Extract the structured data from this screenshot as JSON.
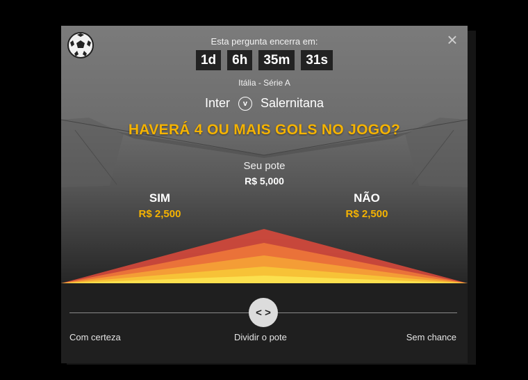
{
  "countdown": {
    "label": "Esta pergunta encerra em:",
    "days": "1d",
    "hours": "6h",
    "minutes": "35m",
    "seconds": "31s"
  },
  "match": {
    "league": "Itália - Série A",
    "home_team": "Inter",
    "vs_symbol": "v",
    "away_team": "Salernitana"
  },
  "question": "HAVERÁ 4 OU MAIS GOLS NO JOGO?",
  "pot": {
    "label": "Seu pote",
    "value": "R$ 5,000"
  },
  "sides": {
    "yes": {
      "label": "SIM",
      "amount": "R$ 2,500"
    },
    "no": {
      "label": "NÃO",
      "amount": "R$ 2,500"
    }
  },
  "slider": {
    "handle_symbol": "< >",
    "options": {
      "left": "Com certeza",
      "center": "Dividir o pote",
      "right": "Sem chance"
    },
    "position": 0.5
  },
  "icons": {
    "sport": "soccer-ball-icon",
    "close": "close-icon",
    "versus": "vs-icon"
  },
  "colors": {
    "accent": "#f5b301",
    "pyramid": [
      "#e04a3c",
      "#f07a3a",
      "#f5a236",
      "#f7c438",
      "#fbe04e"
    ]
  }
}
